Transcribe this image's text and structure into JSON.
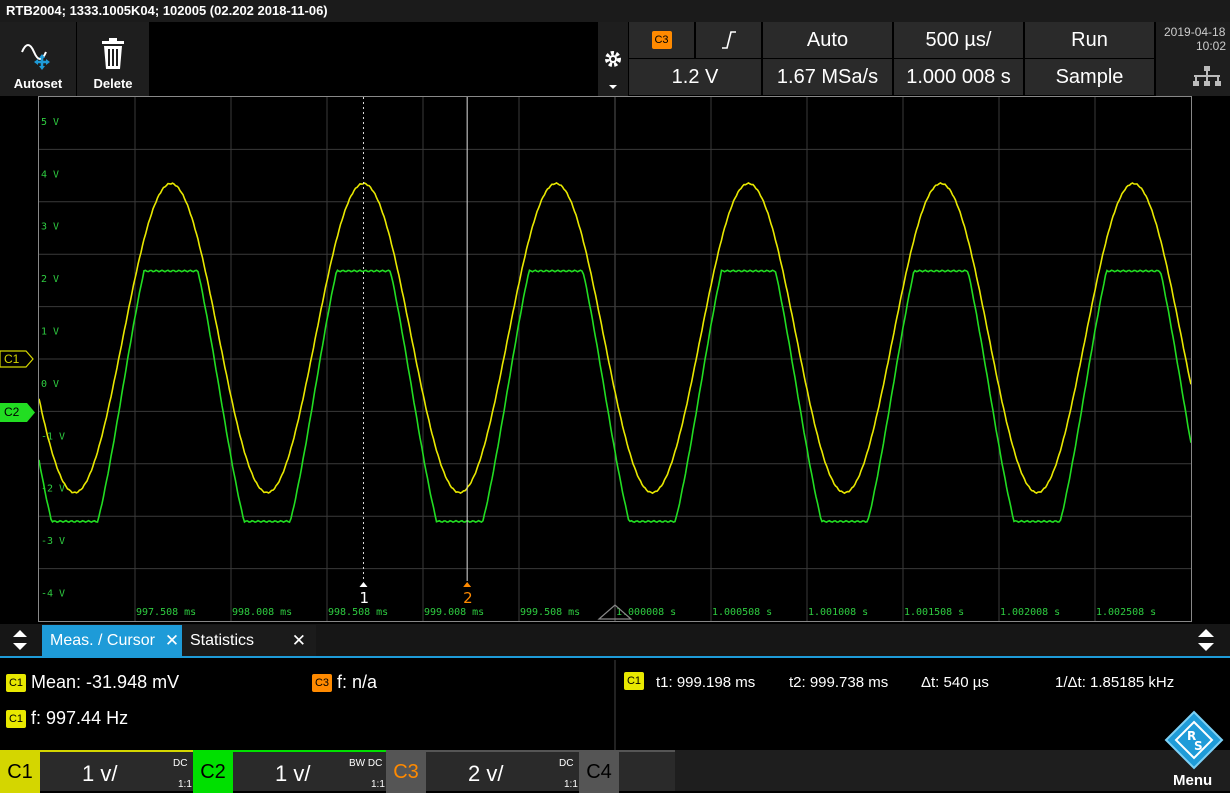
{
  "title": "RTB2004; 1333.1005K04; 102005 (02.202 2018-11-06)",
  "toolbar": {
    "autoset_label": "Autoset",
    "delete_label": "Delete"
  },
  "acquisition": {
    "trigger_source": "C3",
    "trigger_mode": "Auto",
    "timebase": "500 µs/",
    "run_state": "Run",
    "trigger_level": "1.2 V",
    "sample_rate": "1.67 MSa/s",
    "horizontal_position": "1.000 008 s",
    "acq_mode": "Sample"
  },
  "datetime": {
    "date": "2019-04-18",
    "time": "10:02"
  },
  "grid": {
    "y_labels": [
      "5 V",
      "4 V",
      "3 V",
      "2 V",
      "1 V",
      "0 V",
      "-1 V",
      "-2 V",
      "-3 V",
      "-4 V"
    ],
    "x_labels": [
      "997.508 ms",
      "998.008 ms",
      "998.508 ms",
      "999.008 ms",
      "999.508 ms",
      "1.000008 s",
      "1.000508 s",
      "1.001008 s",
      "1.001508 s",
      "1.002008 s",
      "1.002508 s"
    ],
    "cursor1_label": "1",
    "cursor2_label": "2",
    "c1_marker": "C1",
    "c2_marker": "C2"
  },
  "tabs": {
    "meas_cursor": "Meas. / Cursor",
    "statistics": "Statistics",
    "close_glyph": "✕"
  },
  "measurements": {
    "c1_badge": "C1",
    "mean": "Mean: -31.948 mV",
    "freq": "f: 997.44 Hz",
    "c3_badge": "C3",
    "c3_freq": "f: n/a",
    "cursor_badge": "C1",
    "t1": "t1: 999.198 ms",
    "t2": "t2: 999.738 ms",
    "dt": "Δt: 540 µs",
    "inv_dt": "1/Δt: 1.85185 kHz"
  },
  "channels": [
    {
      "name": "C1",
      "scale": "1 v/",
      "coupling": "DC",
      "probe": "1:1",
      "color": "#d4d600"
    },
    {
      "name": "C2",
      "scale": "1 v/",
      "coupling": "BW DC",
      "probe": "1:1",
      "color": "#00e000"
    },
    {
      "name": "C3",
      "scale": "2 v/",
      "coupling": "DC",
      "probe": "1:1",
      "color": "#ff8a00"
    },
    {
      "name": "C4"
    }
  ],
  "menu_label": "Menu",
  "colors": {
    "c1": "#e8e800",
    "c2": "#22dd22",
    "c3": "#ff8a00",
    "accent": "#1e9bd8"
  }
}
